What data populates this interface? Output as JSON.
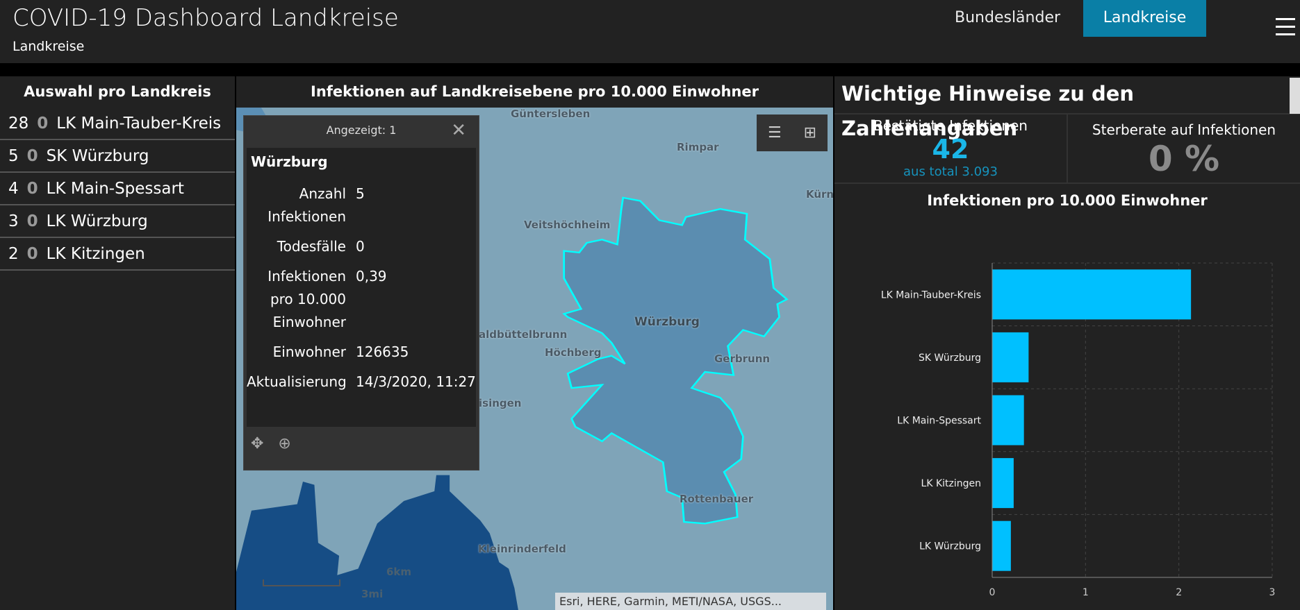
{
  "header": {
    "title": "COVID-19 Dashboard Landkreise",
    "subtitle": "Landkreise",
    "nav": [
      "Bundesländer",
      "Landkreise"
    ]
  },
  "left": {
    "title": "Auswahl pro Landkreis",
    "items": [
      {
        "count": "28",
        "deaths": "0",
        "name": "LK Main-Tauber-Kreis"
      },
      {
        "count": "5",
        "deaths": "0",
        "name": "SK Würzburg"
      },
      {
        "count": "4",
        "deaths": "0",
        "name": "LK Main-Spessart"
      },
      {
        "count": "3",
        "deaths": "0",
        "name": "LK Würzburg"
      },
      {
        "count": "2",
        "deaths": "0",
        "name": "LK Kitzingen"
      }
    ]
  },
  "map": {
    "title": "Infektionen auf Landkreisebene pro 10.000 Einwohner",
    "labels": [
      "Güntersleben",
      "Rimpar",
      "Kürna",
      "Veitshöchheim",
      "Würzburg",
      "aldbüttelbrunn",
      "Höchberg",
      "Gerbrunn",
      "isingen",
      "Rottenbauer",
      "Kleinrinderfeld"
    ],
    "scale_km": "6km",
    "scale_mi": "3mi",
    "attribution": "Esri, HERE, Garmin, METI/NASA, USGS...",
    "popup": {
      "header": "Angezeigt: 1",
      "title": "Würzburg",
      "fields": [
        {
          "k": "Anzahl Infektionen",
          "v": "5"
        },
        {
          "k": "Todesfälle",
          "v": "0"
        },
        {
          "k": "Infektionen pro 10.000 Einwohner",
          "v": "0,39"
        },
        {
          "k": "Einwohner",
          "v": "126635"
        },
        {
          "k": "Aktualisierung",
          "v": "14/3/2020, 11:27"
        }
      ]
    }
  },
  "right": {
    "title": "Wichtige Hinweise zu den Zahlenangaben",
    "kpi1": {
      "label": "Bestätigte Infektionen",
      "value": "42",
      "sub": "aus total 3.093"
    },
    "kpi2": {
      "label": "Sterberate auf Infektionen",
      "value": "0 %"
    }
  },
  "colors": {
    "accent": "#0a7fa6",
    "bar": "#00c0ff",
    "outline": "#00ffff"
  },
  "chart_data": {
    "type": "bar",
    "orientation": "horizontal",
    "title": "Infektionen pro 10.000 Einwohner",
    "categories": [
      "LK Main-Tauber-Kreis",
      "SK Würzburg",
      "LK Main-Spessart",
      "LK Kitzingen",
      "LK Würzburg"
    ],
    "values": [
      2.13,
      0.39,
      0.34,
      0.23,
      0.2
    ],
    "xlim": [
      0,
      3
    ],
    "xticks": [
      "0",
      "1",
      "2",
      "3"
    ],
    "grid": true
  }
}
